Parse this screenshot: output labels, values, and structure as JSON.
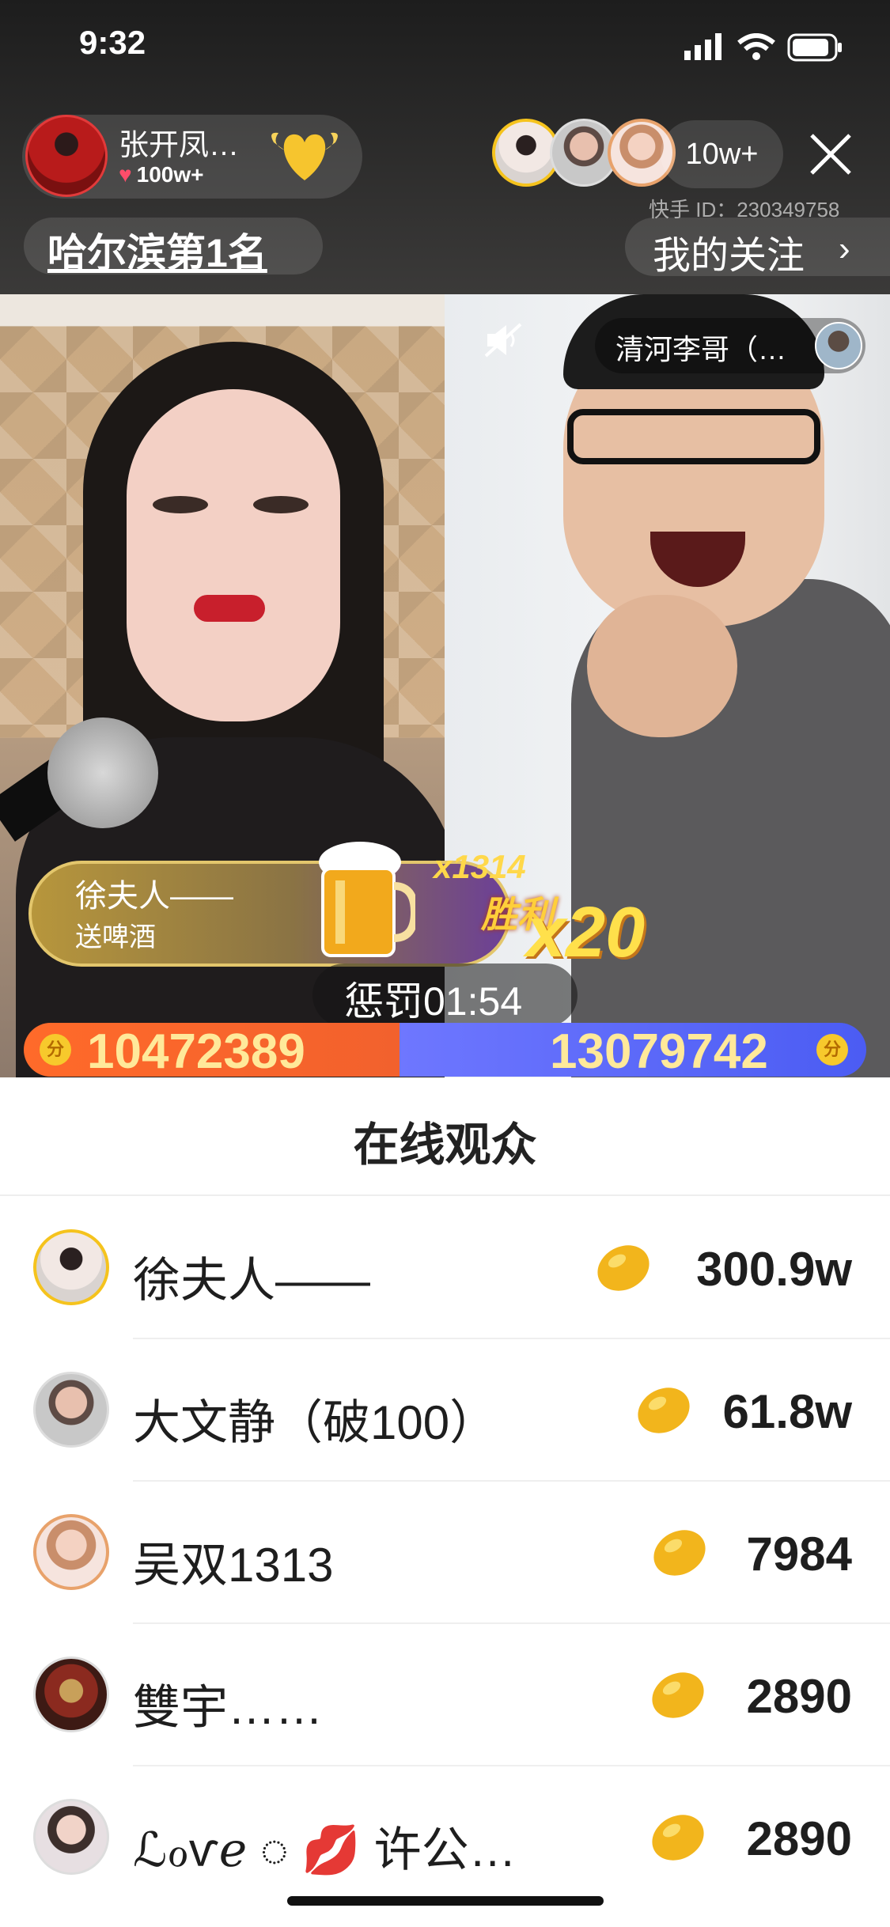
{
  "status_bar": {
    "time": "9:32"
  },
  "header": {
    "host_name": "张开凤…",
    "host_likes": "100w+",
    "rank_label": "哈尔滨第1名",
    "viewer_count": "10w+",
    "kuaishou_id": "快手 ID：230349758",
    "my_follow": "我的关注"
  },
  "pk": {
    "guest_name": "清河李哥（…",
    "gift_user": "徐夫人——",
    "gift_text": "送啤酒",
    "gift_multiplier": "x1314",
    "win_label": "胜利",
    "win_count": "x20",
    "punish_timer": "惩罚01:54",
    "coin_label": "分",
    "score_left": "10472389",
    "score_right": "13079742"
  },
  "audience": {
    "title": "在线观众",
    "rows": [
      {
        "name": "徐夫人——",
        "value": "300.9w"
      },
      {
        "name": "大文静（破100）",
        "value": "61.8w"
      },
      {
        "name": "吴双1313",
        "value": "7984"
      },
      {
        "name": "雙宇……",
        "value": "2890"
      },
      {
        "name": "ℒℴѵℯ ◌ 💋 许公…",
        "value": "2890"
      }
    ]
  },
  "colors": {
    "score_left": "#f2612d",
    "score_right": "#4b5cf3",
    "gold": "#f7c92c"
  }
}
